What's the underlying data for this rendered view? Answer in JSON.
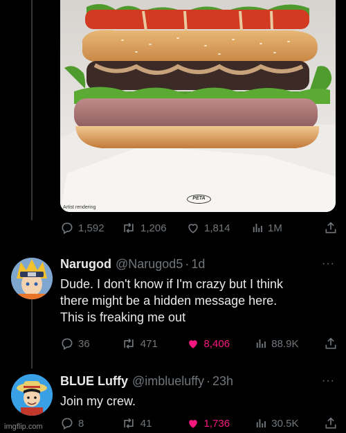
{
  "media": {
    "caption": "Artist rendering",
    "logo_text": "PETA"
  },
  "main_tweet": {
    "stats": {
      "replies": "1,592",
      "retweets": "1,206",
      "likes": "1,814",
      "views": "1M"
    }
  },
  "replies": [
    {
      "name": "Narugod",
      "handle": "@Narugod5",
      "time": "1d",
      "lines": [
        "Dude. I don't know if I'm crazy but I think",
        "there might be a hidden message here.",
        "This is freaking me out"
      ],
      "stats": {
        "replies": "36",
        "retweets": "471",
        "likes": "8,406",
        "views": "88.9K"
      },
      "liked": true
    },
    {
      "name": "BLUE Luffy",
      "handle": "@imblueluffy",
      "time": "23h",
      "lines": [
        "Join my crew."
      ],
      "stats": {
        "replies": "8",
        "retweets": "41",
        "likes": "1,736",
        "views": "30.5K"
      },
      "liked": true
    }
  ],
  "ui": {
    "separator": "·",
    "more": "···",
    "watermark": "imgflip.com"
  },
  "colors": {
    "background": "#000000",
    "text": "#e7e9ea",
    "muted": "#71767b",
    "like_pink": "#f91880"
  }
}
